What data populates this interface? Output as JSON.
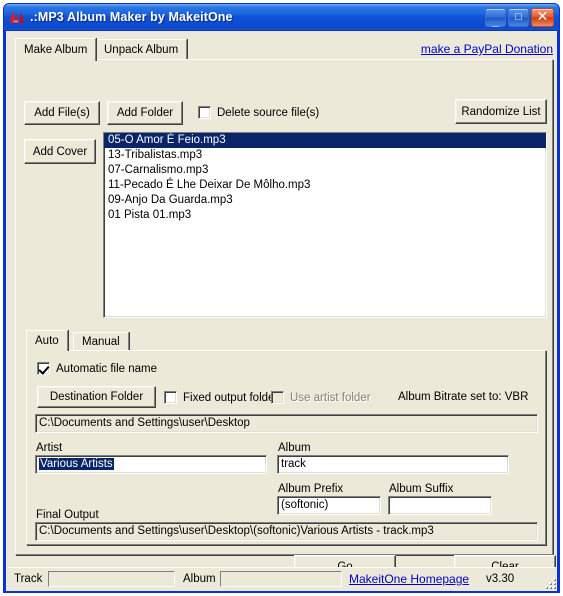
{
  "window": {
    "title": ".:MP3 Album Maker by MakeitOne",
    "icon": "mp3-album-maker-logo",
    "minimize_label": "_",
    "maximize_label": "□",
    "close_label": "✕",
    "accent_color": "#0831d9",
    "face_color": "#ece9d8",
    "selection_color": "#0a246a"
  },
  "tabs": {
    "items": [
      {
        "label": "Make Album",
        "active": true
      },
      {
        "label": "Unpack Album",
        "active": false
      }
    ],
    "donation_link": "make a PayPal Donation"
  },
  "toolbar": {
    "add_files_label": "Add File(s)",
    "add_folder_label": "Add Folder",
    "delete_source_label": "Delete source file(s)",
    "delete_source_checked": false,
    "randomize_label": "Randomize List",
    "add_cover_label": "Add Cover"
  },
  "file_list": {
    "items": [
      {
        "name": "05-O Amor É Feio.mp3",
        "selected": true
      },
      {
        "name": "13-Tribalistas.mp3",
        "selected": false
      },
      {
        "name": "07-Carnalismo.mp3",
        "selected": false
      },
      {
        "name": "11-Pecado É Lhe Deixar De Môlho.mp3",
        "selected": false
      },
      {
        "name": "09-Anjo Da Guarda.mp3",
        "selected": false
      },
      {
        "name": "01 Pista 01.mp3",
        "selected": false
      }
    ]
  },
  "inner_tabs": {
    "items": [
      {
        "label": "Auto",
        "active": true
      },
      {
        "label": "Manual",
        "active": false
      }
    ]
  },
  "options": {
    "automatic_file_name_label": "Automatic file name",
    "automatic_file_name_checked": true,
    "destination_folder_label": "Destination Folder",
    "fixed_output_folder_label": "Fixed output folder",
    "fixed_output_folder_checked": false,
    "use_artist_folder_label": "Use artist folder",
    "use_artist_folder_checked": false,
    "use_artist_folder_disabled": true,
    "bitrate_label": "Album Bitrate set to: VBR",
    "destination_path": "C:\\Documents and Settings\\user\\Desktop"
  },
  "fields": {
    "artist_label": "Artist",
    "artist_value": "Various Artists",
    "artist_selected": true,
    "album_label": "Album",
    "album_value": "track",
    "album_prefix_label": "Album Prefix",
    "album_prefix_value": "(softonic)",
    "album_suffix_label": "Album Suffix",
    "album_suffix_value": "",
    "final_output_label": "Final Output",
    "final_output_value": "C:\\Documents and Settings\\user\\Desktop\\(softonic)Various Artists - track.mp3"
  },
  "actions": {
    "go_label": "Go",
    "clear_label": "Clear"
  },
  "statusbar": {
    "track_label": "Track",
    "track_value": "",
    "album_label": "Album",
    "album_value": "",
    "homepage_link": "MakeitOne Homepage",
    "version": "v3.30"
  }
}
